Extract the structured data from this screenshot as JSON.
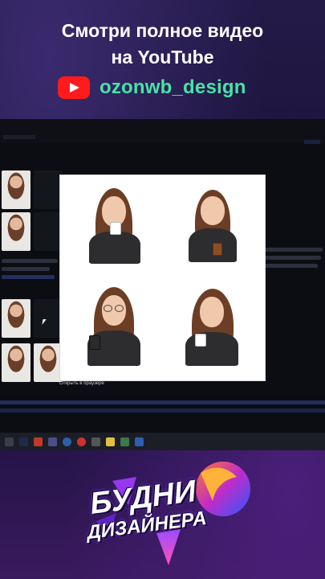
{
  "header": {
    "line1": "Смотри полное видео",
    "line2": "на YouTube",
    "channel": "ozonwb_design"
  },
  "screen": {
    "preview_caption": "Открыть в браузере"
  },
  "logo": {
    "line1": "БУДНИ",
    "line2": "ДИЗАЙНЕРА"
  },
  "colors": {
    "channel_green": "#47e3a6",
    "youtube_red": "#ff1b1b",
    "background": "#1a1238"
  },
  "icons": [
    "youtube-icon",
    "mouse-cursor-icon",
    "windows-taskbar-icons"
  ]
}
